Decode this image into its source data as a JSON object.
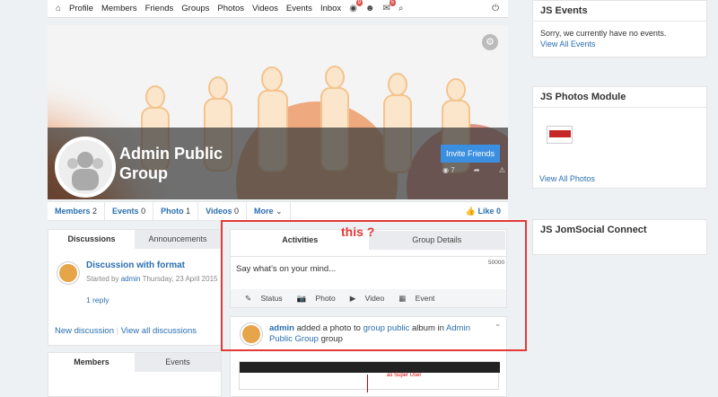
{
  "nav": {
    "items": [
      "Profile",
      "Members",
      "Friends",
      "Groups",
      "Photos",
      "Videos",
      "Events",
      "Inbox"
    ],
    "badges": {
      "globe": "9",
      "inbox": "5"
    },
    "icons": [
      "home-icon",
      "globe-icon",
      "friend-request-icon",
      "mail-icon",
      "search-icon",
      "power-icon"
    ]
  },
  "cover": {
    "group_name": "Admin Public Group",
    "invite_label": "Invite Friends",
    "views": "7"
  },
  "stats": [
    {
      "label": "Members",
      "count": "2"
    },
    {
      "label": "Events",
      "count": "0"
    },
    {
      "label": "Photo",
      "count": "1"
    },
    {
      "label": "Videos",
      "count": "0"
    },
    {
      "label": "More",
      "count": ""
    }
  ],
  "like": {
    "label": "Like",
    "count": "0"
  },
  "discussions": {
    "tabs": [
      "Discussions",
      "Announcements"
    ],
    "title": "Discussion with format",
    "meta_prefix": "Started by",
    "author": "admin",
    "date": "Thursday, 23 April 2015",
    "replies": "1 reply",
    "new_link": "New discussion",
    "all_link": "View all discussions"
  },
  "members": {
    "tabs": [
      "Members",
      "Events"
    ]
  },
  "activity": {
    "tabs": [
      "Activities",
      "Group Details"
    ],
    "placeholder": "Say what's on your mind...",
    "char_count": "50000",
    "post_types": [
      "Status",
      "Photo",
      "Video",
      "Event"
    ]
  },
  "feed": {
    "actor": "admin",
    "text1": "added a photo to",
    "album": "group public",
    "text2": "album in",
    "group": "Admin Public Group",
    "text3": "group",
    "image_caption": "as Super User"
  },
  "annotation": {
    "text": "this ?"
  },
  "sidebar": {
    "events_title": "JS Events",
    "events_empty": "Sorry, we currently have no events.",
    "events_link": "View All Events",
    "photos_title": "JS Photos Module",
    "photos_link": "View All Photos",
    "connect_title": "JS JomSocial Connect"
  }
}
